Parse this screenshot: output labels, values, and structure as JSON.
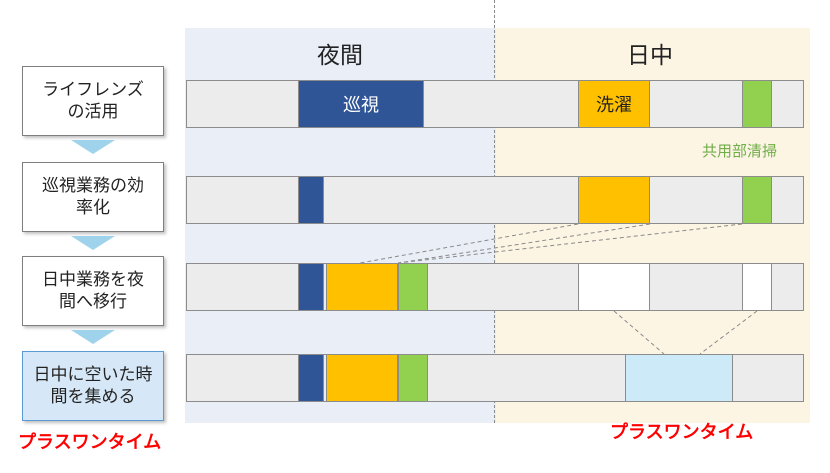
{
  "headers": {
    "night": "夜間",
    "day": "日中"
  },
  "steps": [
    {
      "text": "ライフレンズの活用"
    },
    {
      "text": "巡視業務の効率化"
    },
    {
      "text": "日中業務を夜間へ移行"
    },
    {
      "text": "日中に空いた時間を集める"
    }
  ],
  "segments": {
    "patrol": "巡視",
    "laundry": "洗濯",
    "common_cleaning": "共用部清掃"
  },
  "plus_one_time_left": "プラスワンタイム",
  "plus_one_time_right": "プラスワンタイム",
  "colors": {
    "navy": "#2f5597",
    "gold": "#ffc000",
    "green": "#92d050",
    "light_blue": "#cdeaf8",
    "red": "#ff0000"
  }
}
